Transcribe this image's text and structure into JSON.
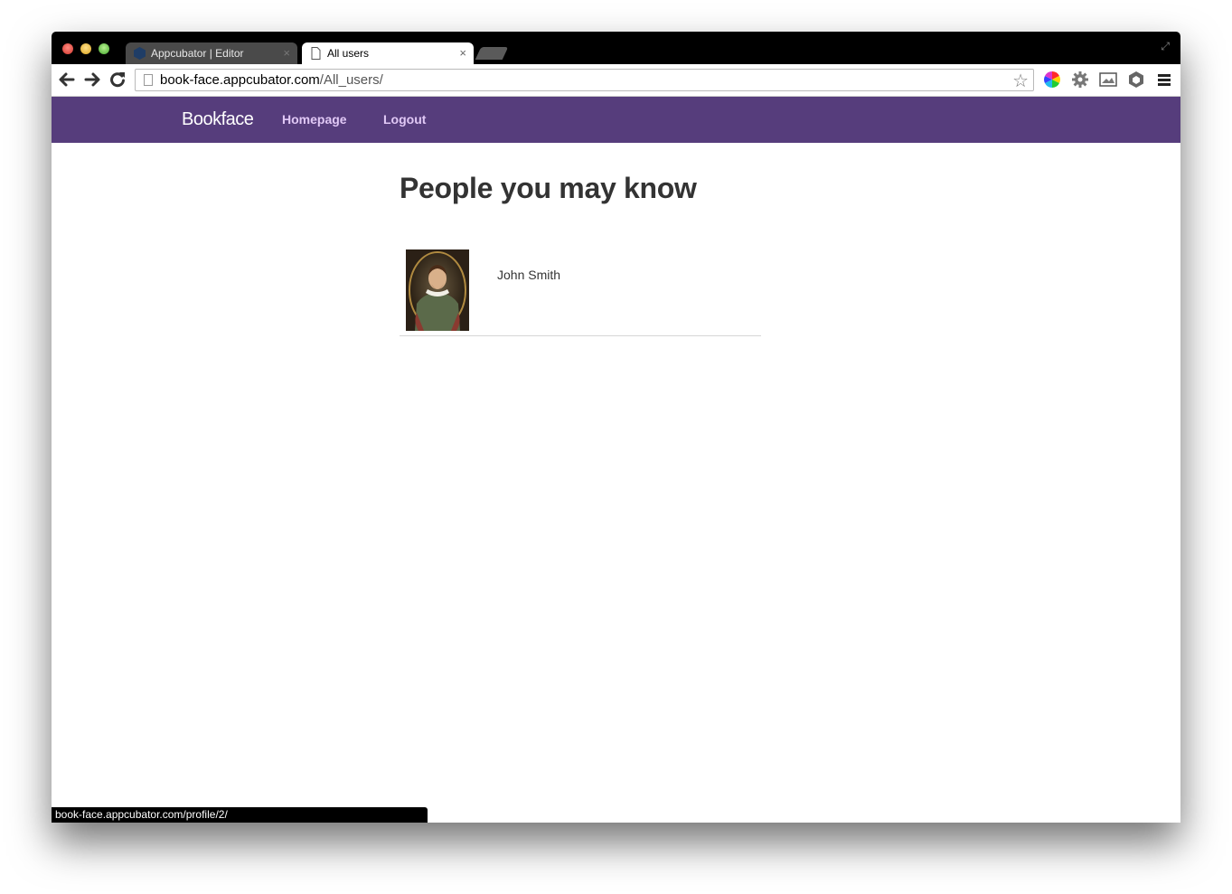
{
  "browser": {
    "tabs": [
      {
        "title": "Appcubator | Editor",
        "active": false
      },
      {
        "title": "All users",
        "active": true
      }
    ],
    "url": {
      "host": "book-face.appcubator.com",
      "path": "/All_users/"
    },
    "status_url": "book-face.appcubator.com/profile/2/"
  },
  "site": {
    "brand": "Bookface",
    "nav": {
      "homepage": "Homepage",
      "logout": "Logout"
    },
    "accent_color": "#563d7c"
  },
  "page": {
    "title": "People you may know",
    "users": [
      {
        "name": "John Smith"
      }
    ]
  }
}
